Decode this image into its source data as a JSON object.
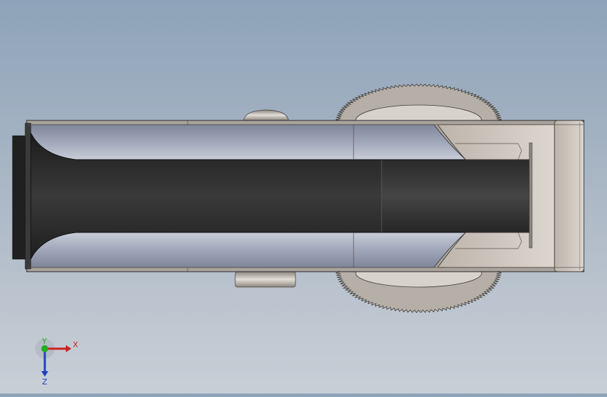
{
  "view": {
    "background_top": "#8ea3b9",
    "background_bottom": "#c9cfd7"
  },
  "model": {
    "body_color": "#a9a39c",
    "belt_color": "#2b2b2b",
    "channel_color": "#9aa2b4",
    "end_block_color": "#cfc7bf",
    "gear_color": "#b2aba4"
  },
  "triad": {
    "x_label": "X",
    "y_label": "Y",
    "z_label": "Z",
    "x_color": "#d02020",
    "y_color": "#20b020",
    "z_color": "#2040c0"
  }
}
